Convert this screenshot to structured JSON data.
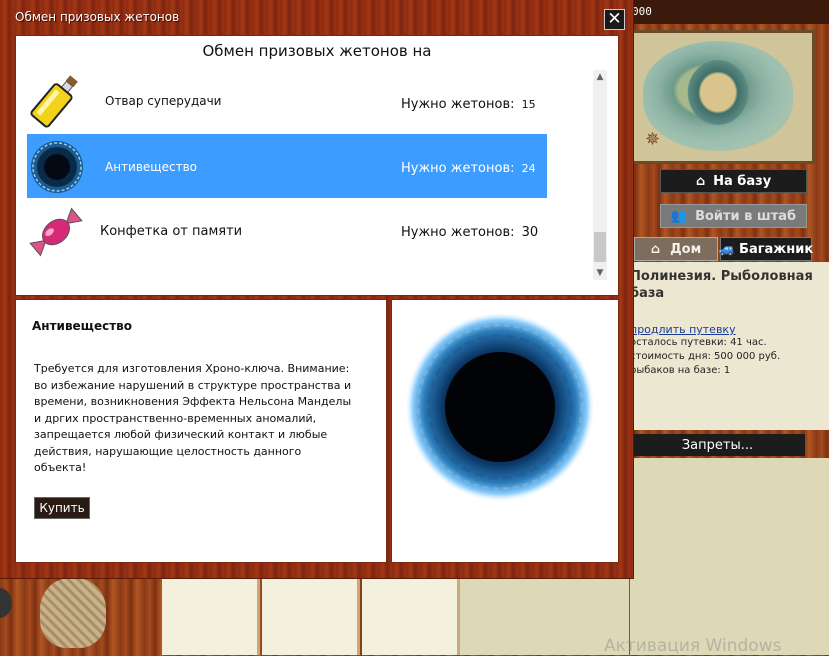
{
  "background": {
    "topbar_text": "000",
    "base_button": "На базу",
    "hq_button": "Войти в штаб",
    "home_button": "Дом",
    "trunk_button": "Багажник",
    "location_title": "Полинезия. Рыболовная база",
    "extend_link": "продлить путевку",
    "info_lines": [
      "осталось путевки: 41 час.",
      "стоимость дня: 500 000 руб.",
      "рыбаков на базе: 1"
    ],
    "bans_button": "Запреты...",
    "watermark": "Активация Windows"
  },
  "dialog": {
    "title": "Обмен призовых жетонов",
    "close_label": "✕",
    "header": "Обмен призовых жетонов на",
    "cost_label": "Нужно жетонов:",
    "items": [
      {
        "name": "Отвар суперудачи",
        "cost": "15",
        "icon": "potion-bottle-icon"
      },
      {
        "name": "Антивещество",
        "cost": "24",
        "icon": "antimatter-icon"
      },
      {
        "name": "Конфетка от памяти",
        "cost": "30",
        "icon": "candy-icon"
      }
    ],
    "selected_index": 1,
    "scroll_up": "▲",
    "scroll_down": "▼",
    "detail": {
      "title": "Антивещество",
      "description": "Требуется для изготовления Хроно-ключа. Внимание: во избежание нарушений в структуре пространства и времени, возникновения Эффекта Нельсона Манделы и дргих пространственно-временных аномалий, запрещается любой физический контакт и любые действия, нарушающие целостность данного объекта!",
      "buy_label": "Купить",
      "image_icon": "antimatter-large-icon"
    }
  },
  "colors": {
    "selection": "#3d9cff",
    "frame": "#a33814"
  }
}
